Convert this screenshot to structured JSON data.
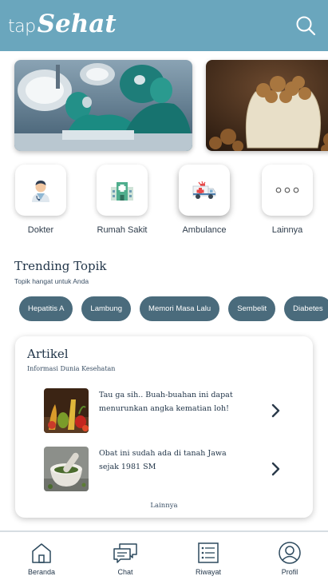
{
  "header": {
    "logo_tap": "tap",
    "logo_sehat": "Sehat",
    "background": "#6aa6bd",
    "search_icon": "search-icon"
  },
  "banners": [
    {
      "name": "surgery-banner"
    },
    {
      "name": "walnuts-banner"
    }
  ],
  "categories": [
    {
      "label": "Dokter",
      "icon": "doctor-icon"
    },
    {
      "label": "Rumah Sakit",
      "icon": "hospital-icon"
    },
    {
      "label": "Ambulance",
      "icon": "ambulance-icon"
    },
    {
      "label": "Lainnya",
      "icon": "more-icon"
    }
  ],
  "trending": {
    "title": "Trending Topik",
    "subtitle": "Topik hangat untuk Anda",
    "chip_color": "#4a6b7c",
    "topics": [
      "Hepatitis A",
      "Lambung",
      "Memori Masa Lalu",
      "Sembelit",
      "Diabetes"
    ]
  },
  "artikel": {
    "title": "Artikel",
    "subtitle": "Informasi Dunia Kesehatan",
    "items": [
      {
        "title": "Tau ga sih.. Buah-buahan ini dapat menurunkan angka kematian loh!",
        "thumb": "vegetables-thumbnail"
      },
      {
        "title": "Obat ini sudah ada di tanah Jawa sejak 1981 SM",
        "thumb": "mortar-pestle-thumbnail"
      }
    ],
    "more_label": "Lainnya"
  },
  "bottom_nav": [
    {
      "label": "Beranda",
      "icon": "home-icon"
    },
    {
      "label": "Chat",
      "icon": "chat-icon"
    },
    {
      "label": "Riwayat",
      "icon": "history-icon"
    },
    {
      "label": "Profil",
      "icon": "profile-icon"
    }
  ]
}
